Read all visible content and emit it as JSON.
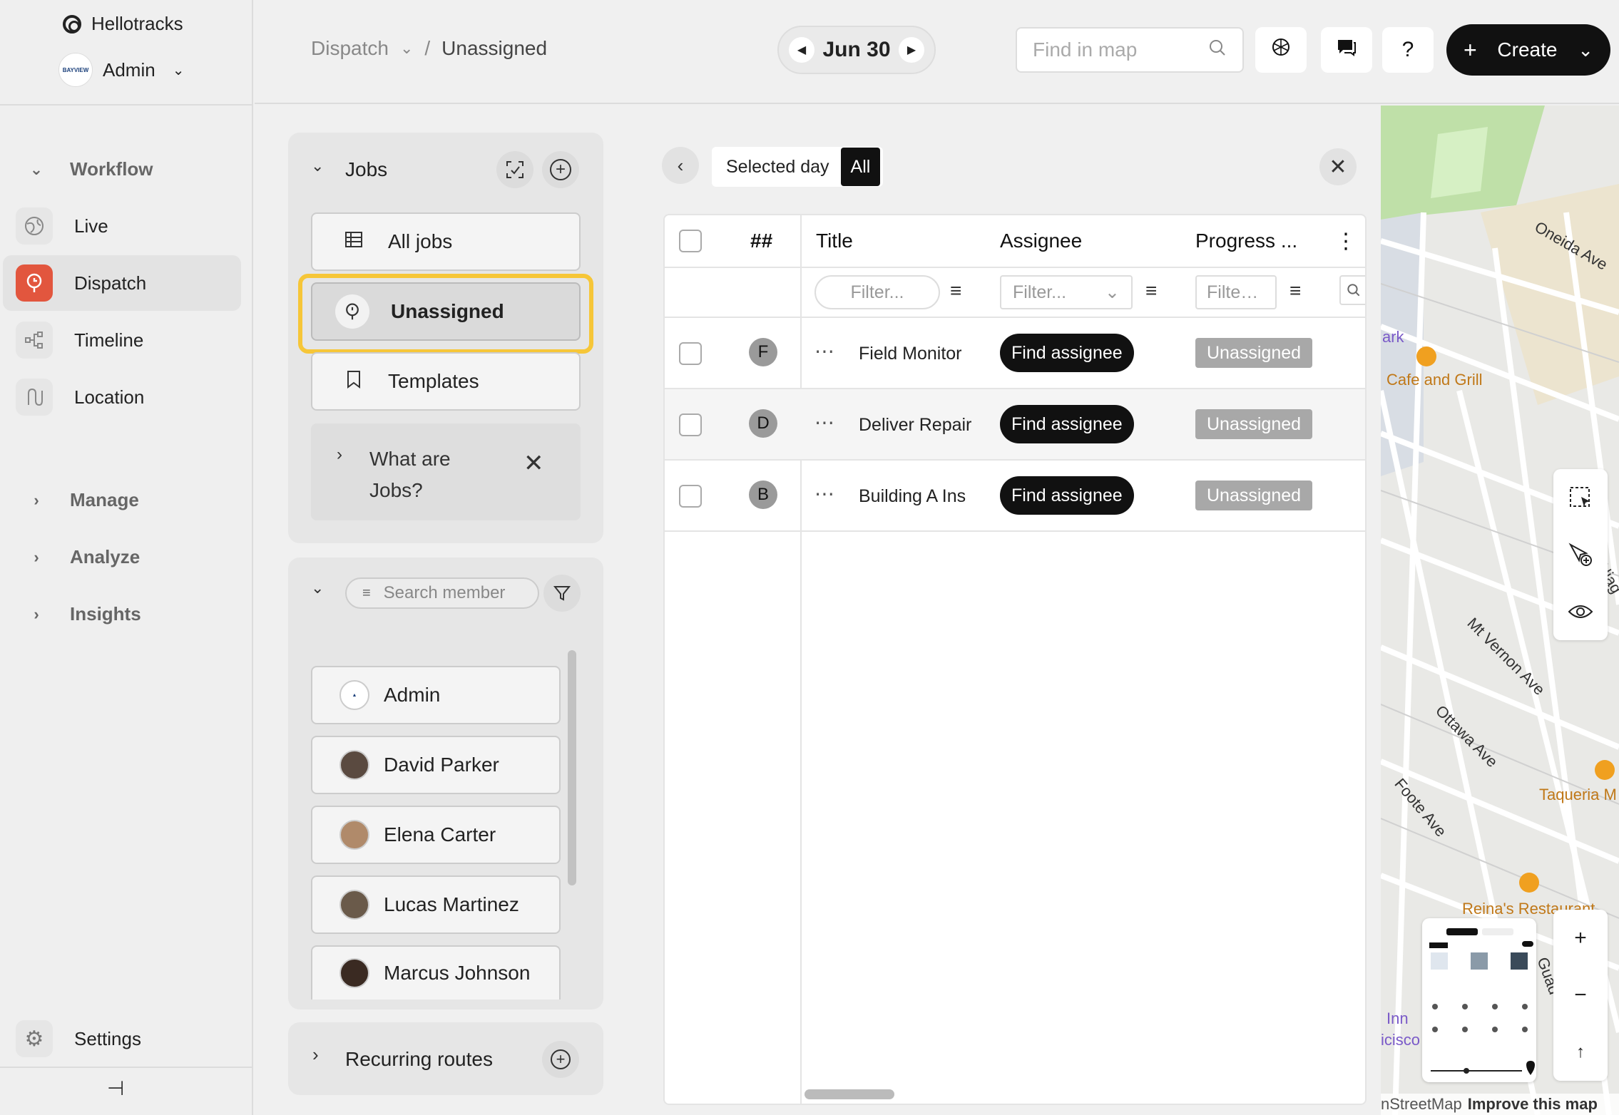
{
  "app": {
    "name": "Hellotracks",
    "org": "Admin",
    "org_logo_text": "BAYVIEW"
  },
  "nav": {
    "workflow": "Workflow",
    "items": [
      {
        "label": "Live",
        "icon": "globe-icon"
      },
      {
        "label": "Dispatch",
        "icon": "dispatch-icon"
      },
      {
        "label": "Timeline",
        "icon": "timeline-icon"
      },
      {
        "label": "Location",
        "icon": "route-icon"
      }
    ],
    "sections": [
      "Manage",
      "Analyze",
      "Insights"
    ],
    "settings": "Settings"
  },
  "topbar": {
    "breadcrumb_root": "Dispatch",
    "breadcrumb_sep": "/",
    "breadcrumb_current": "Unassigned",
    "date": "Jun 30",
    "search_placeholder": "Find in map",
    "help": "?",
    "create": "Create"
  },
  "jobs_panel": {
    "title": "Jobs",
    "all_jobs": "All jobs",
    "unassigned": "Unassigned",
    "templates": "Templates",
    "hint_line1": "What are",
    "hint_line2": "Jobs?"
  },
  "members_panel": {
    "search_placeholder": "Search member",
    "members": [
      "Admin",
      "David Parker",
      "Elena Carter",
      "Lucas Martinez",
      "Marcus Johnson"
    ]
  },
  "routes_panel": {
    "title": "Recurring routes"
  },
  "table": {
    "scope_selected_day": "Selected day",
    "scope_all": "All",
    "headers": {
      "num": "##",
      "title": "Title",
      "assignee": "Assignee",
      "progress": "Progress ..."
    },
    "filter_placeholder": "Filter...",
    "filter_short": "Filte…",
    "rows": [
      {
        "letter": "F",
        "title": "Field Monitor",
        "assign": "Find assignee",
        "status": "Unassigned"
      },
      {
        "letter": "D",
        "title": "Deliver Repair",
        "assign": "Find assignee",
        "status": "Unassigned"
      },
      {
        "letter": "B",
        "title": "Building A Ins",
        "assign": "Find assignee",
        "status": "Unassigned"
      }
    ]
  },
  "map": {
    "labels": [
      "Oneida Ave",
      "Cafe and Grill",
      "ark",
      "Niag",
      "Mt Vernon Ave",
      "Ottawa Ave",
      "Foote Ave",
      "Taqueria M",
      "Reina's Restaurant",
      "Inn",
      "icisco",
      "Guad"
    ],
    "attribution": "nStreetMap",
    "improve": "Improve this map",
    "zoom_in": "+",
    "zoom_out": "−"
  }
}
